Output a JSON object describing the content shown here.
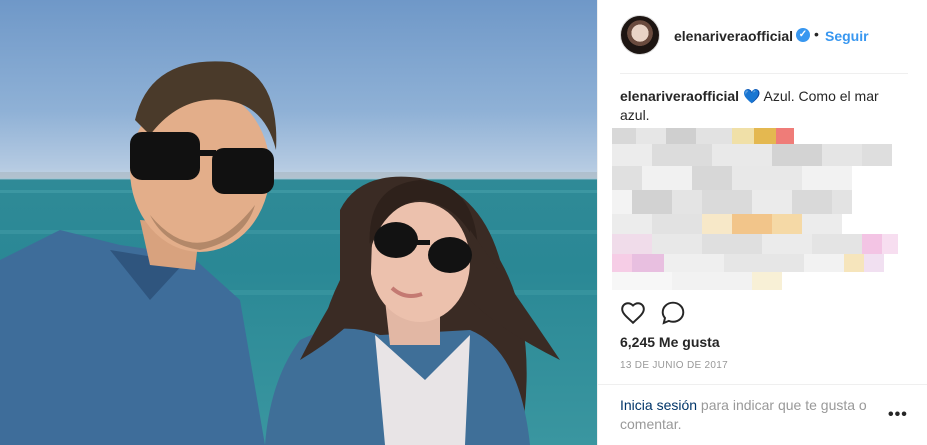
{
  "post": {
    "username": "elenariveraofficial",
    "verified_glyph": "✓",
    "separator": "•",
    "follow_label": "Seguir",
    "caption": {
      "username": "elenariveraofficial",
      "emoji": "💙",
      "text": "Azul. Como el mar azul."
    },
    "likes": "6,245 Me gusta",
    "date": "13 DE JUNIO DE 2017",
    "login": {
      "link": "Inicia sesión",
      "text": " para indicar que te gusta o comentar."
    },
    "more_glyph": "•••"
  },
  "icons": {
    "like": "heart-outline-icon",
    "comment": "speech-bubble-icon",
    "verified": "verified-badge-icon",
    "more": "more-options-icon"
  },
  "colors": {
    "accent": "#3897f0",
    "link": "#003569",
    "muted": "#999999",
    "text": "#262626"
  }
}
